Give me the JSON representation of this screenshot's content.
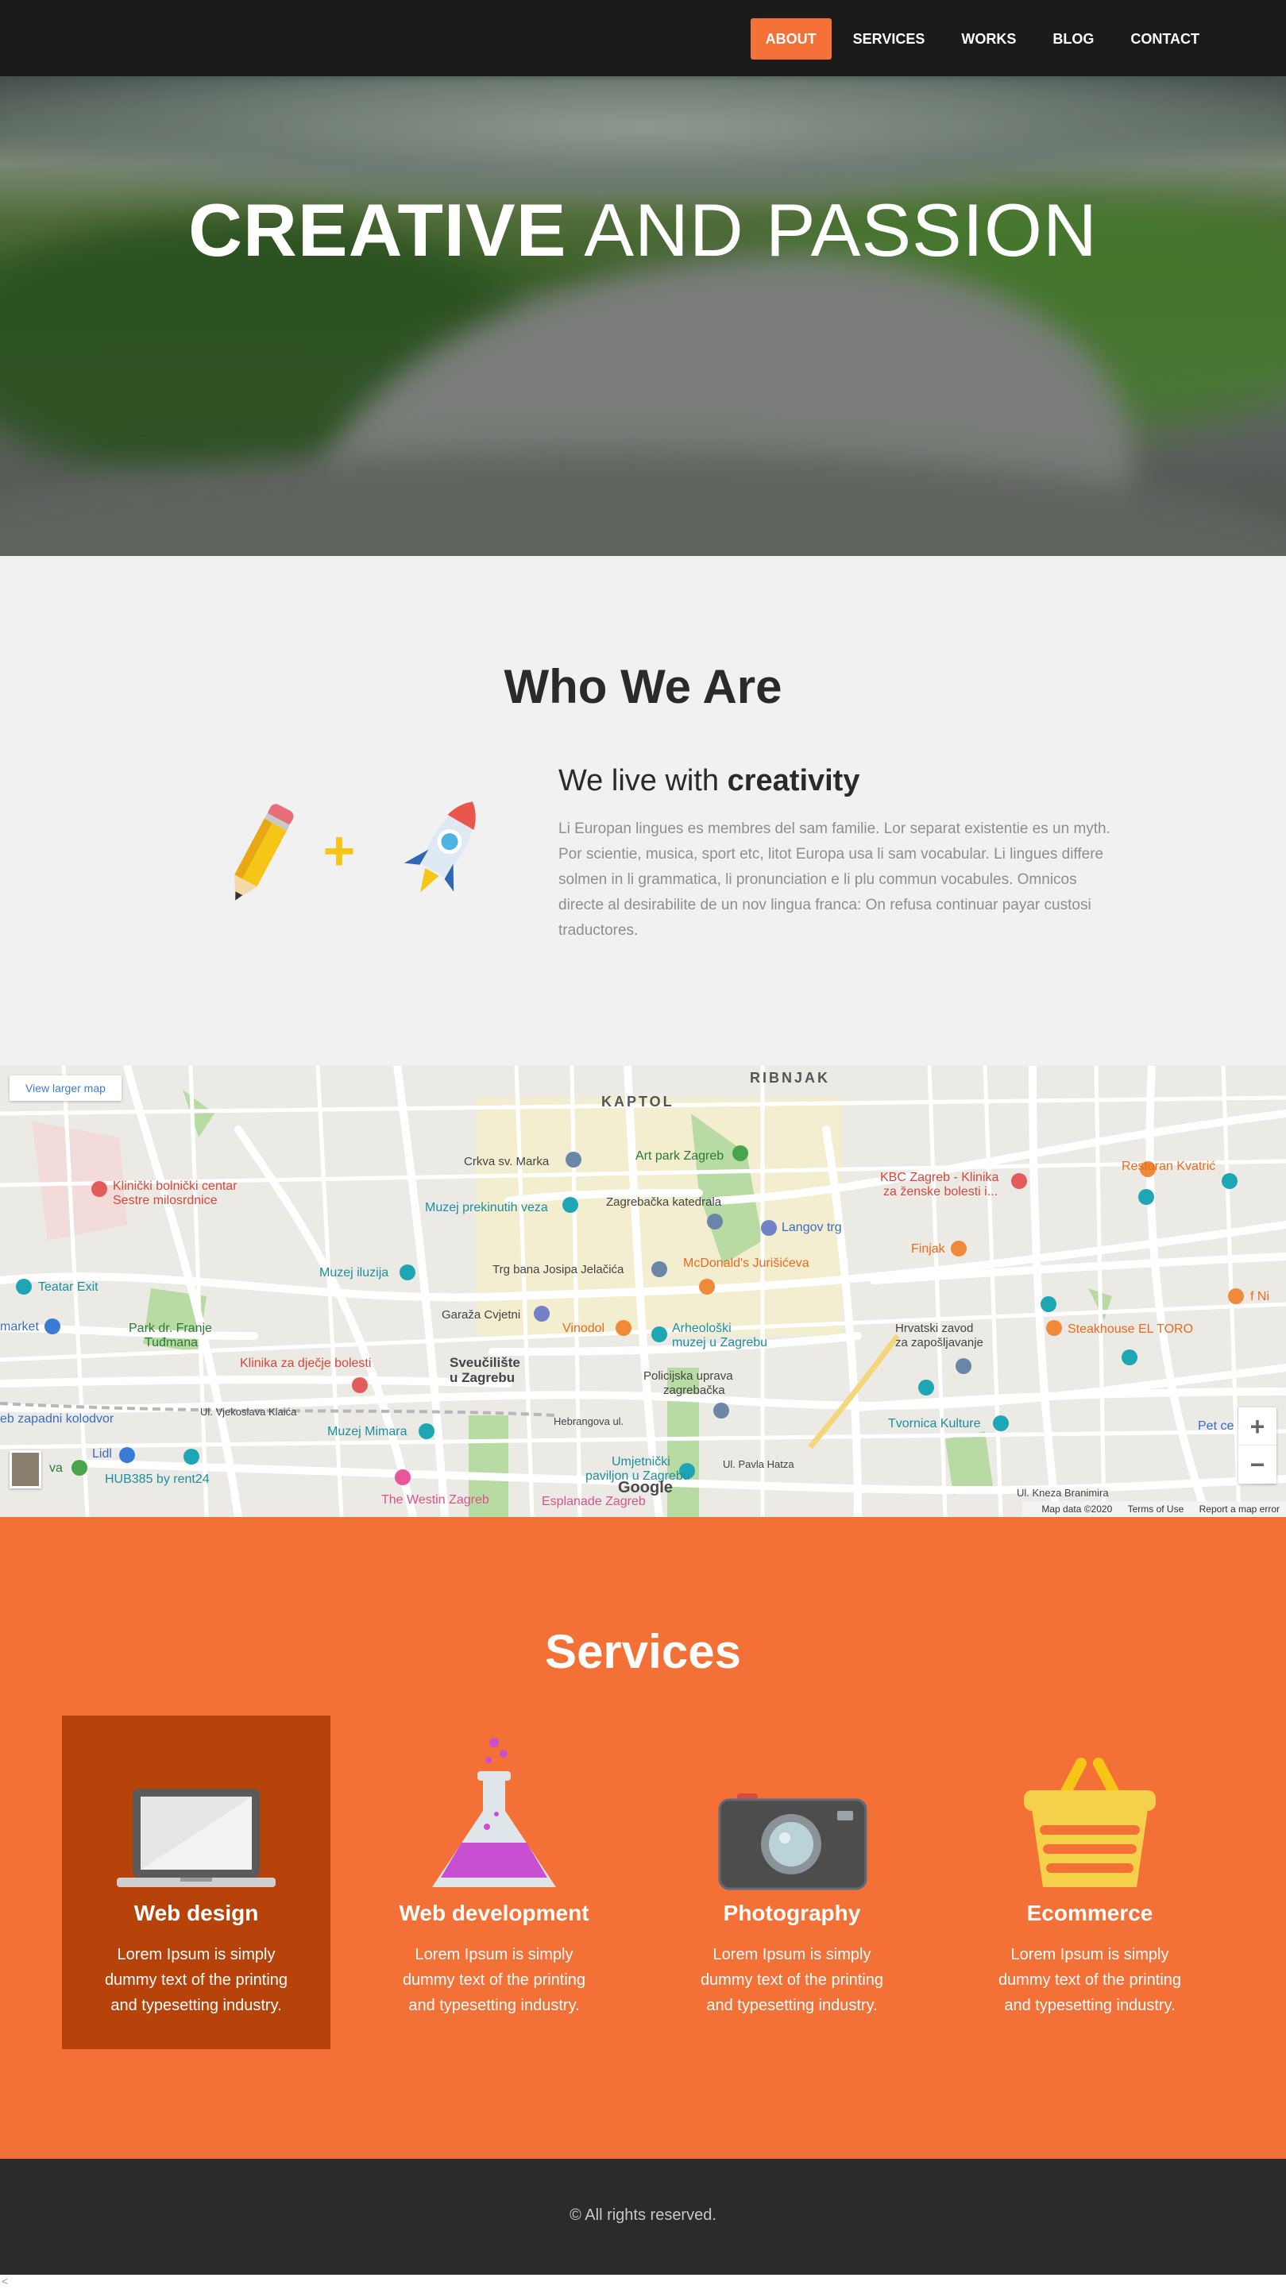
{
  "nav": {
    "items": [
      {
        "label": "ABOUT",
        "active": true
      },
      {
        "label": "SERVICES",
        "active": false
      },
      {
        "label": "WORKS",
        "active": false
      },
      {
        "label": "BLOG",
        "active": false
      },
      {
        "label": "CONTACT",
        "active": false
      }
    ],
    "accent_color": "#f37136"
  },
  "hero": {
    "title_bold": "CREATIVE",
    "title_light": " AND PASSION"
  },
  "who": {
    "heading": "Who We Are",
    "subheading_plain": "We live with ",
    "subheading_bold": "creativity",
    "plus": "+",
    "body": "Li Europan lingues es membres del sam familie. Lor separat existentie es un myth. Por scientie, musica, sport etc, litot Europa usa li sam vocabular. Li lingues differe solmen in li grammatica, li pronunciation e li plu commun vocabules. Omnicos directe al desirabilite de un nov lingua franca: On refusa continuar payar custosi traductores."
  },
  "map": {
    "view_larger": "View larger map",
    "zoom_in": "+",
    "zoom_out": "−",
    "map_data": "Map data ©2020",
    "terms": "Terms of Use",
    "report": "Report a map error",
    "google": "Google",
    "labels": {
      "kaptol": "KAPTOL",
      "ribnjak": "RIBNJAK",
      "klinicki": "Klinički bolnički centar",
      "sestre": "Sestre milosrdnice",
      "crkva": "Crkva sv. Marka",
      "artpark": "Art park Zagreb",
      "muzej_prek": "Muzej prekinutih veza",
      "katedrala": "Zagrebačka katedrala",
      "langov": "Langov trg",
      "kbc": "KBC Zagreb - Klinika",
      "kbc2": "za ženske bolesti i...",
      "restoran": "Restoran Kvatrić",
      "finjak": "Finjak",
      "teatar": "Teatar Exit",
      "muzej_iluz": "Muzej iluzija",
      "trg": "Trg bana Josipa Jelačića",
      "mcd": "McDonald's Jurišićeva",
      "market": "market",
      "park": "Park dr. Franje",
      "park2": "Tuđmana",
      "garaza": "Garaža Cvjetni",
      "vinodol": "Vinodol",
      "arheo": "Arheološki",
      "arheo2": "muzej u Zagrebu",
      "hrvatski": "Hrvatski zavod",
      "hrvatski2": "za zapošljavanje",
      "steak": "Steakhouse EL TORO",
      "klinika_dj": "Klinika za dječje bolesti",
      "sveuc": "Sveučilište",
      "sveuc2": "u Zagrebu",
      "policija": "Policijska uprava",
      "policija2": "zagrebačka",
      "zapadni": "eb zapadni kolodvor",
      "vjekoslava": "Ul. Vjekoslava Klaića",
      "hebrang": "Hebrangova ul.",
      "tvornica": "Tvornica Kulture",
      "muzej_mim": "Muzej Mimara",
      "lidl": "Lidl",
      "hub": "HUB385 by rent24",
      "umjet": "Umjetnički",
      "umjet2": "paviljon u Zagrebu",
      "pavia": "Ul. Pavla Hatza",
      "westin": "The Westin Zagreb",
      "esplanade": "Esplanade Zagreb",
      "branimira": "Ul. Kneza Branimira",
      "petc": "Pet ce",
      "nil": "f Ni",
      "va": "va"
    }
  },
  "services": {
    "heading": "Services",
    "items": [
      {
        "title": "Web design",
        "text": "Lorem Ipsum is simply dummy text of the printing and typesetting industry.",
        "icon": "laptop-icon",
        "active": true
      },
      {
        "title": "Web development",
        "text": "Lorem Ipsum is simply dummy text of the printing and typesetting industry.",
        "icon": "flask-icon",
        "active": false
      },
      {
        "title": "Photography",
        "text": "Lorem Ipsum is simply dummy text of the printing and typesetting industry.",
        "icon": "camera-icon",
        "active": false
      },
      {
        "title": "Ecommerce",
        "text": "Lorem Ipsum is simply dummy text of the printing and typesetting industry.",
        "icon": "basket-icon",
        "active": false
      }
    ],
    "bg_color": "#f37136",
    "active_color": "#b8430a"
  },
  "footer": {
    "copyright": "© All rights reserved."
  },
  "tail_char": "<"
}
